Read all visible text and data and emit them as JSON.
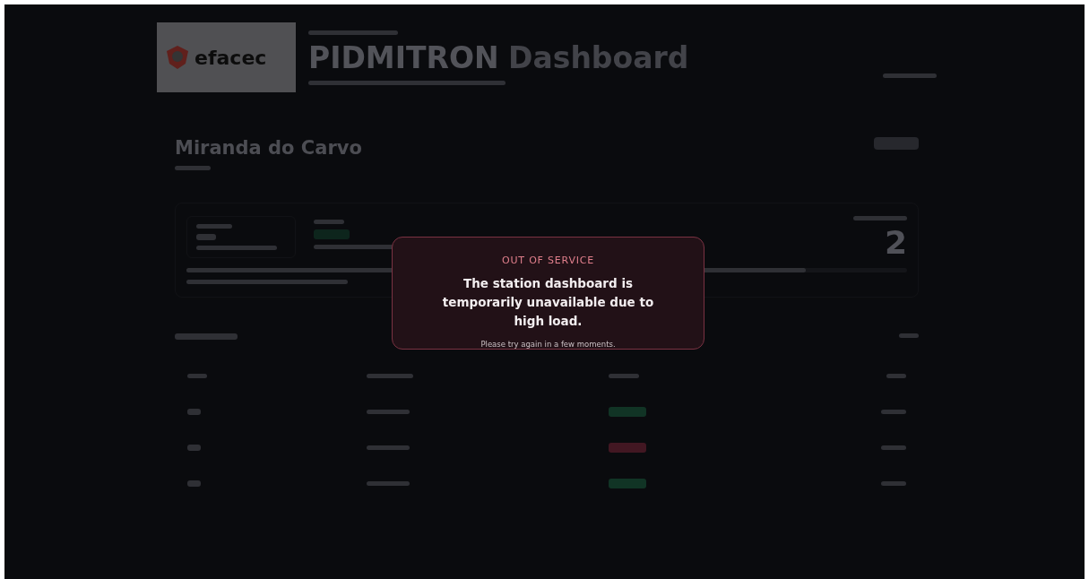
{
  "header": {
    "logo": "efacec",
    "title_bold": "PIDMITRON",
    "title_light": "Dashboard"
  },
  "station": {
    "name": "Miranda do Carvo",
    "big_value": "2",
    "level": 0.86
  },
  "table": {
    "rows": [
      {
        "color": "#143a2a"
      },
      {
        "color": "#4a1a26"
      },
      {
        "color": "#143a2a"
      }
    ]
  },
  "modal": {
    "eyebrow": "OUT OF SERVICE",
    "message": "The station dashboard is temporarily unavailable due to high load.",
    "hint": "Please try again in a few moments."
  }
}
